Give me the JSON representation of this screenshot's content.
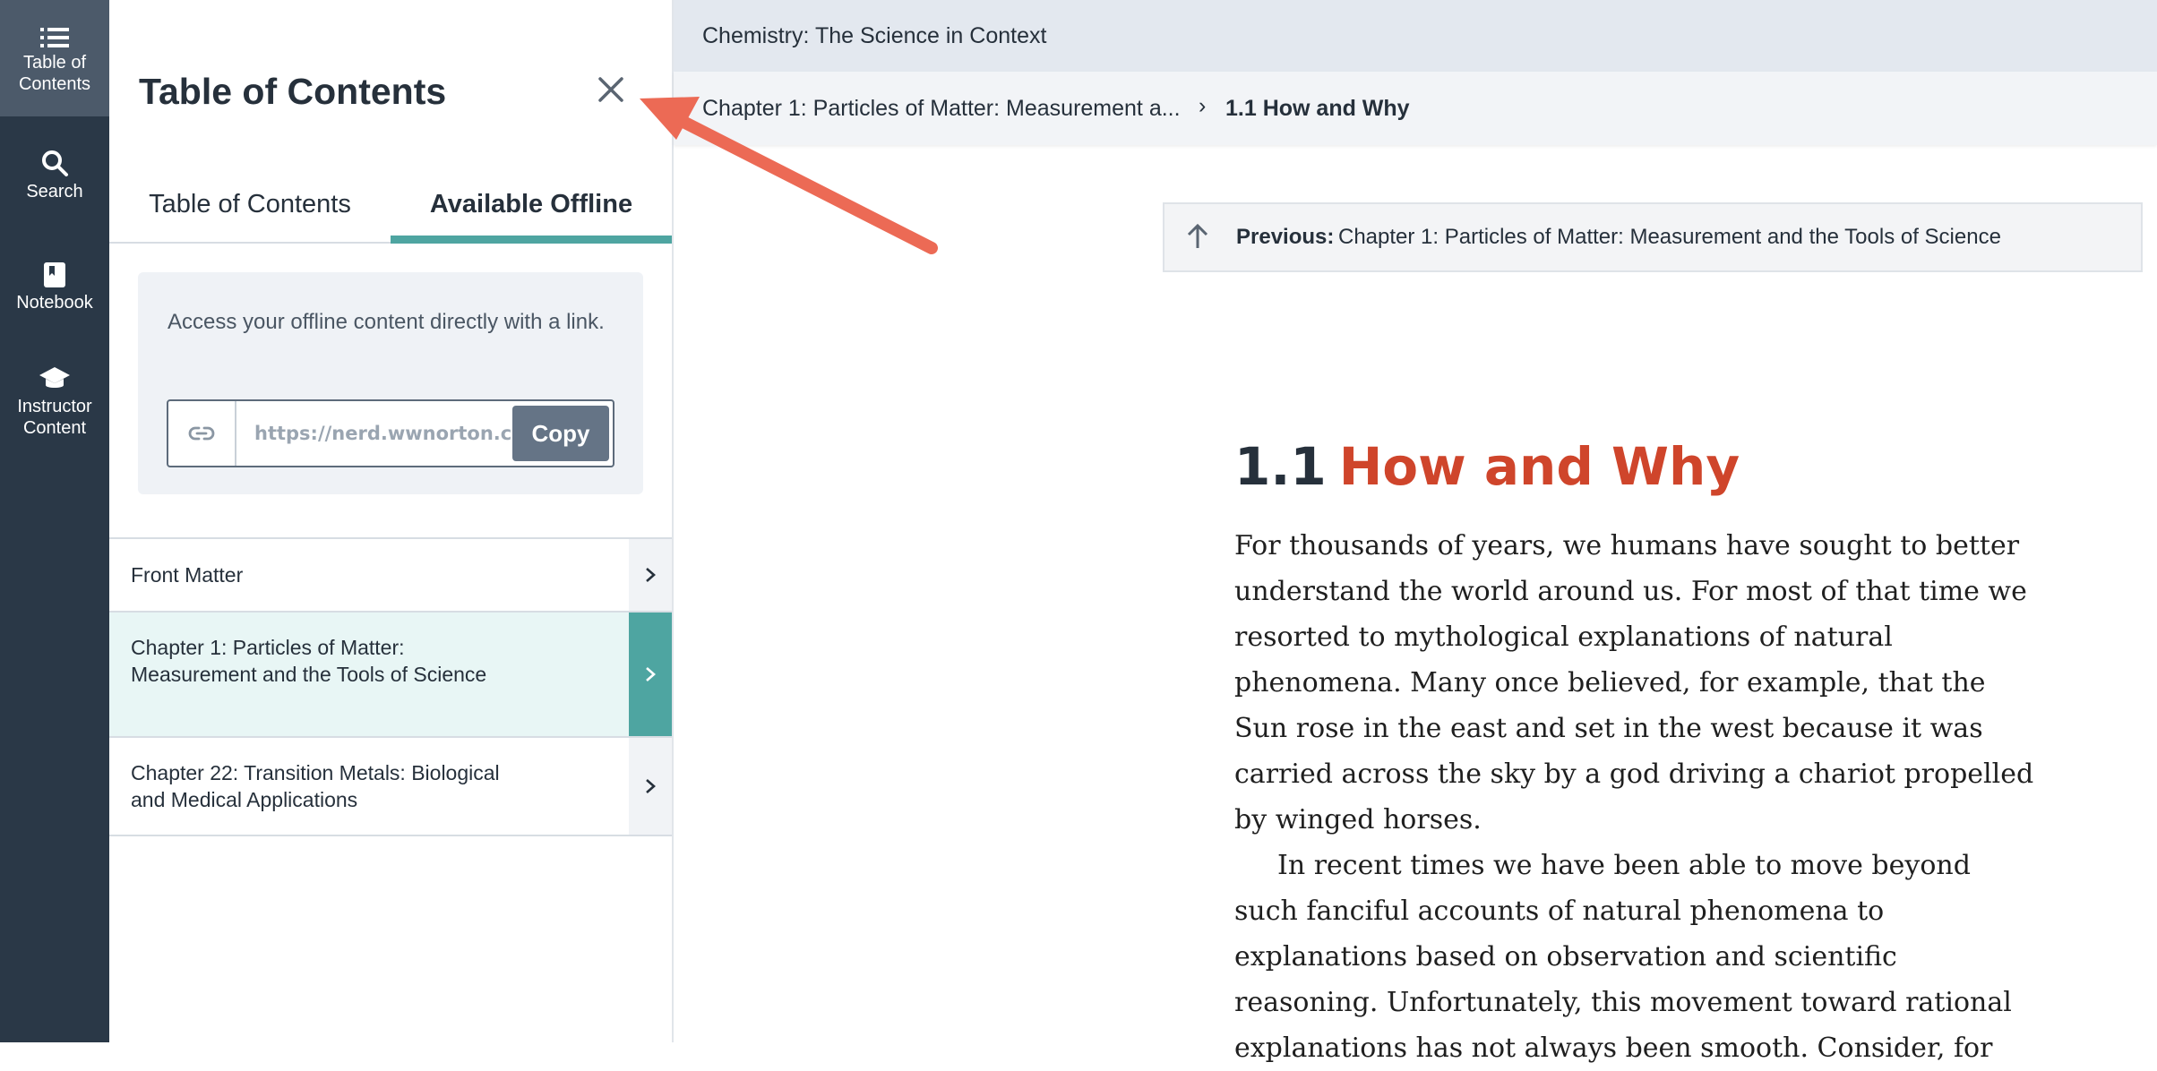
{
  "rail": {
    "items": [
      {
        "label_line1": "Table of",
        "label_line2": "Contents",
        "icon": "list-icon"
      },
      {
        "label_line1": "Search",
        "label_line2": "",
        "icon": "search-icon"
      },
      {
        "label_line1": "Notebook",
        "label_line2": "",
        "icon": "notebook-icon"
      },
      {
        "label_line1": "Instructor",
        "label_line2": "Content",
        "icon": "graduation-cap-icon"
      }
    ]
  },
  "panel": {
    "title": "Table of Contents",
    "tabs": [
      {
        "label": "Table of Contents"
      },
      {
        "label": "Available Offline"
      }
    ],
    "offline": {
      "description": "Access your offline content directly with a link.",
      "url": "https://nerd.wwnorton.com",
      "copy_label": "Copy"
    },
    "toc_items": [
      {
        "label": "Front Matter"
      },
      {
        "label": "Chapter 1: Particles of Matter: Measurement and the Tools of Science"
      },
      {
        "label": "Chapter 22: Transition Metals: Biological and Medical Applications"
      }
    ]
  },
  "main": {
    "book_title": "Chemistry: The Science in Context",
    "breadcrumb": {
      "chapter": "Chapter 1: Particles of Matter: Measurement a...",
      "separator": "›",
      "current": "1.1 How and Why"
    },
    "previous": {
      "label": "Previous:",
      "text": "Chapter 1: Particles of Matter: Measurement and the Tools of Science"
    },
    "section": {
      "number": "1.1",
      "title": "How and Why"
    },
    "paragraphs": [
      "For thousands of years, we humans have sought to better understand the world around us. For most of that time we resorted to mythological explanations of natural phenomena. Many once believed, for example, that the Sun rose in the east and set in the west because it was carried across the sky by a god driving a chariot propelled by winged horses.",
      "In recent times we have been able to move beyond such fanciful accounts of natural phenomena to explanations based on observation and scientific reasoning. Unfortunately, this movement toward rational explanations has not always been smooth. Consider, for"
    ]
  },
  "colors": {
    "rail_bg": "#2a3847",
    "accent_teal": "#4ea5a1",
    "title_red": "#cf452b",
    "annotation_arrow": "#ec6a55"
  }
}
